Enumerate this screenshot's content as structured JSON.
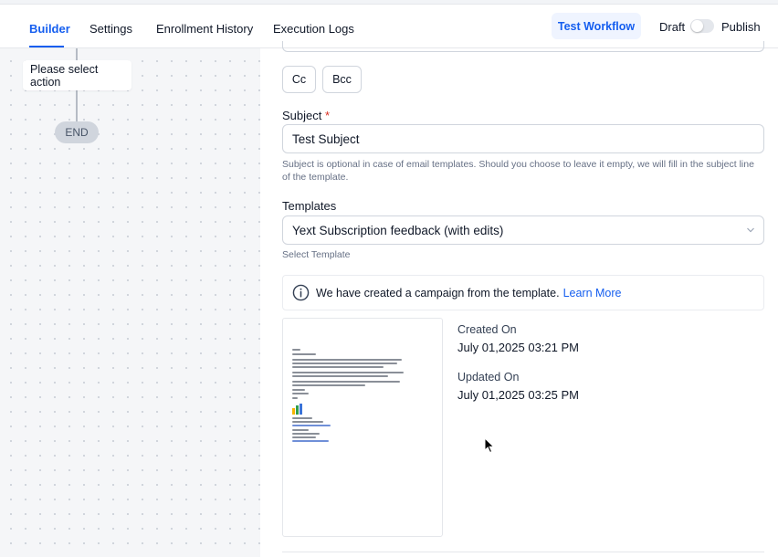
{
  "header": {
    "tabs": [
      {
        "label": "Builder",
        "active": true
      },
      {
        "label": "Settings",
        "active": false
      },
      {
        "label": "Enrollment History",
        "active": false
      },
      {
        "label": "Execution Logs",
        "active": false
      }
    ],
    "workflow_button": "Test Workflow",
    "draft_label": "Draft",
    "publish_label": "Publish",
    "publish_toggle_on": false
  },
  "canvas": {
    "action_node_label": "Please select action",
    "end_label": "END"
  },
  "form": {
    "cc_label": "Cc",
    "bcc_label": "Bcc",
    "subject_label": "Subject",
    "subject_required_mark": "*",
    "subject_value": "Test Subject",
    "subject_help": "Subject is optional in case of email templates. Should you choose to leave it empty, we will fill in the subject line of the template.",
    "templates_label": "Templates",
    "template_selected": "Yext Subscription feedback (with edits)",
    "template_help": "Select Template",
    "info_text": "We have created a campaign from the template.",
    "info_link": "Learn More",
    "created_on_label": "Created On",
    "created_on_value": "July 01,2025 03:21 PM",
    "updated_on_label": "Updated On",
    "updated_on_value": "July 01,2025 03:25 PM"
  },
  "colors": {
    "accent": "#155eef",
    "required": "#d92d20",
    "canvas_bg": "#f5f6f8"
  }
}
